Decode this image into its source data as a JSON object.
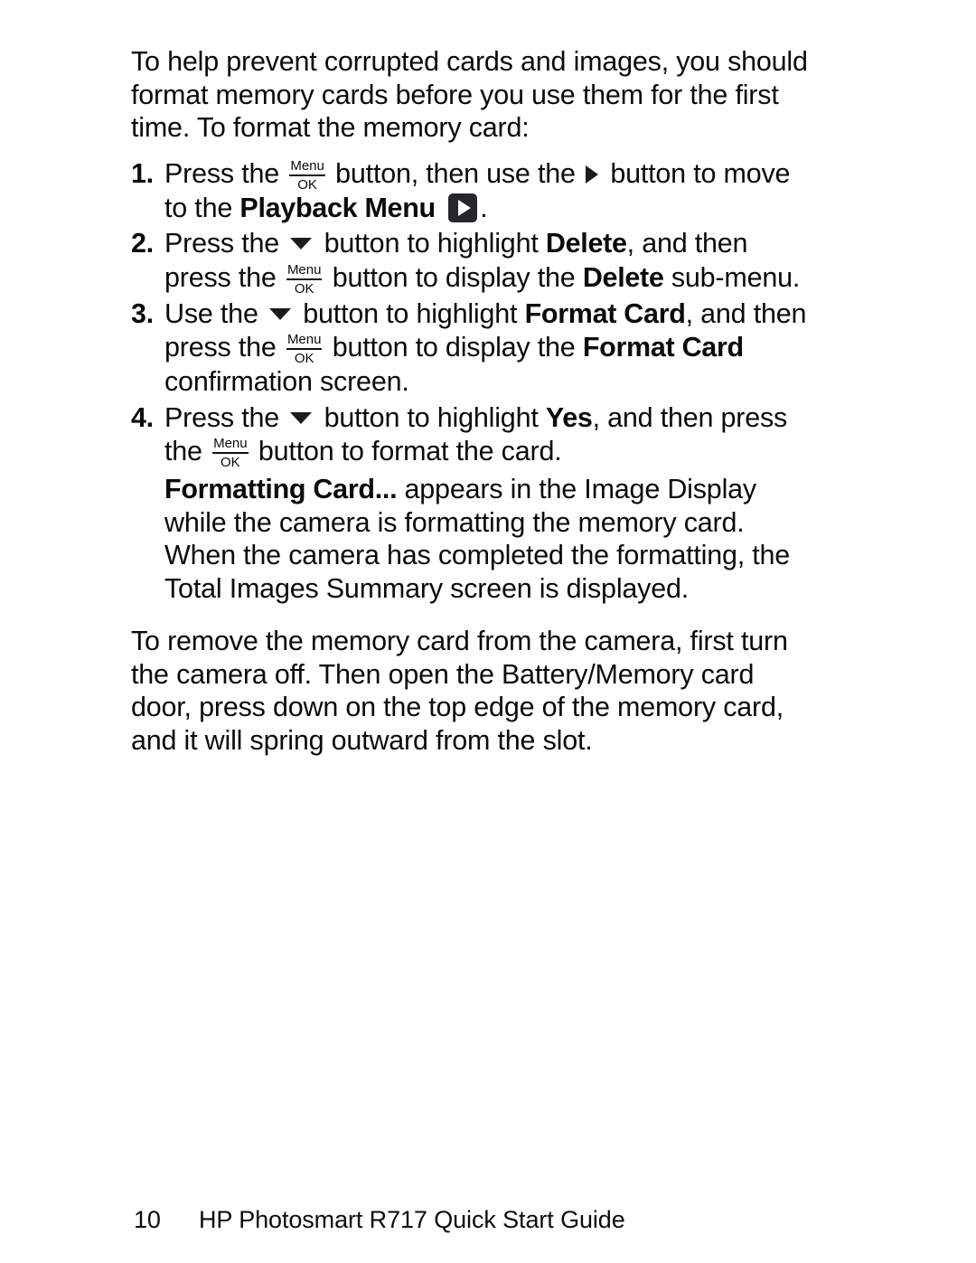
{
  "document": {
    "intro": {
      "text": "To help prevent corrupted cards and images, you should format memory cards before you use them for the first time. To format the memory card:"
    },
    "steps": [
      {
        "number": "1.",
        "segments": {
          "s1": "Press the",
          "icon1": "menu-ok-button-icon",
          "s2": "button, then use the",
          "icon2": "right-arrow-icon",
          "s3": "button to move to the",
          "bold1": "Playback Menu",
          "icon3": "playback-mode-icon",
          "s4": "."
        }
      },
      {
        "number": "2.",
        "segments": {
          "s1": "Press the",
          "icon1": "down-arrow-icon",
          "s2": "button to highlight",
          "bold1": "Delete",
          "s3": ", and then press the",
          "icon2": "menu-ok-button-icon",
          "s4": "button to display the",
          "bold2": "Delete",
          "s5": "sub-menu."
        }
      },
      {
        "number": "3.",
        "segments": {
          "s1": "Use the",
          "icon1": "down-arrow-icon",
          "s2": "button to highlight",
          "bold1": "Format Card",
          "s3": ", and then press the",
          "icon2": "menu-ok-button-icon",
          "s4": "button to display the",
          "bold2": "Format Card",
          "s5": "confirmation screen."
        }
      },
      {
        "number": "4.",
        "segments": {
          "s1": "Press the",
          "icon1": "down-arrow-icon",
          "s2": "button to highlight",
          "bold1": "Yes",
          "s3": ", and then press the",
          "icon2": "menu-ok-button-icon",
          "s4": "button to format the card."
        }
      }
    ],
    "note": {
      "bold_lead": "Formatting Card...",
      "text": "appears in the Image Display while the camera is formatting the memory card. When the camera has completed the formatting, the Total Images Summary screen is displayed."
    },
    "closing": {
      "text": "To remove the memory card from the camera, first turn the camera off. Then open the Battery/Memory card door, press down on the top edge of the memory card, and it will spring outward from the slot."
    }
  },
  "icons": {
    "menu_ok": {
      "top_label": "Menu",
      "bottom_label": "OK"
    }
  },
  "footer": {
    "page_number": "10",
    "guide_title": "HP Photosmart R717 Quick Start Guide"
  },
  "colors": {
    "page_background": "#ffffff",
    "text": "#0b0b0b",
    "icon_fill": "#1b1b1b",
    "playback_button_background": "#27272b",
    "playback_button_glyph": "#ffffff"
  }
}
